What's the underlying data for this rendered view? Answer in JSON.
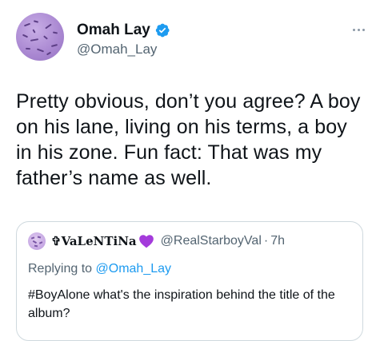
{
  "author": {
    "display_name": "Omah Lay",
    "handle": "@Omah_Lay",
    "verified": true,
    "avatar_color": "#a987d1"
  },
  "tweet": {
    "text": "Pretty obvious, don’t you agree? A boy on his lane, living on his terms, a boy in his zone. Fun fact: That was my father’s name as well."
  },
  "quoted_tweet": {
    "display_name": "✞VaLeNTiNa",
    "emoji": "purple-heart-icon",
    "handle": "@RealStarboyVal",
    "separator": "·",
    "time": "7h",
    "replying_to_label": "Replying to",
    "replying_to_handle": "@Omah_Lay",
    "text": "#BoyAlone what's the inspiration behind the title of the album?"
  },
  "colors": {
    "text": "#0f1419",
    "secondary": "#536471",
    "link": "#1d9bf0",
    "verified": "#1d9bf0",
    "border": "#cfd9de",
    "heart": "#a43bdb"
  }
}
